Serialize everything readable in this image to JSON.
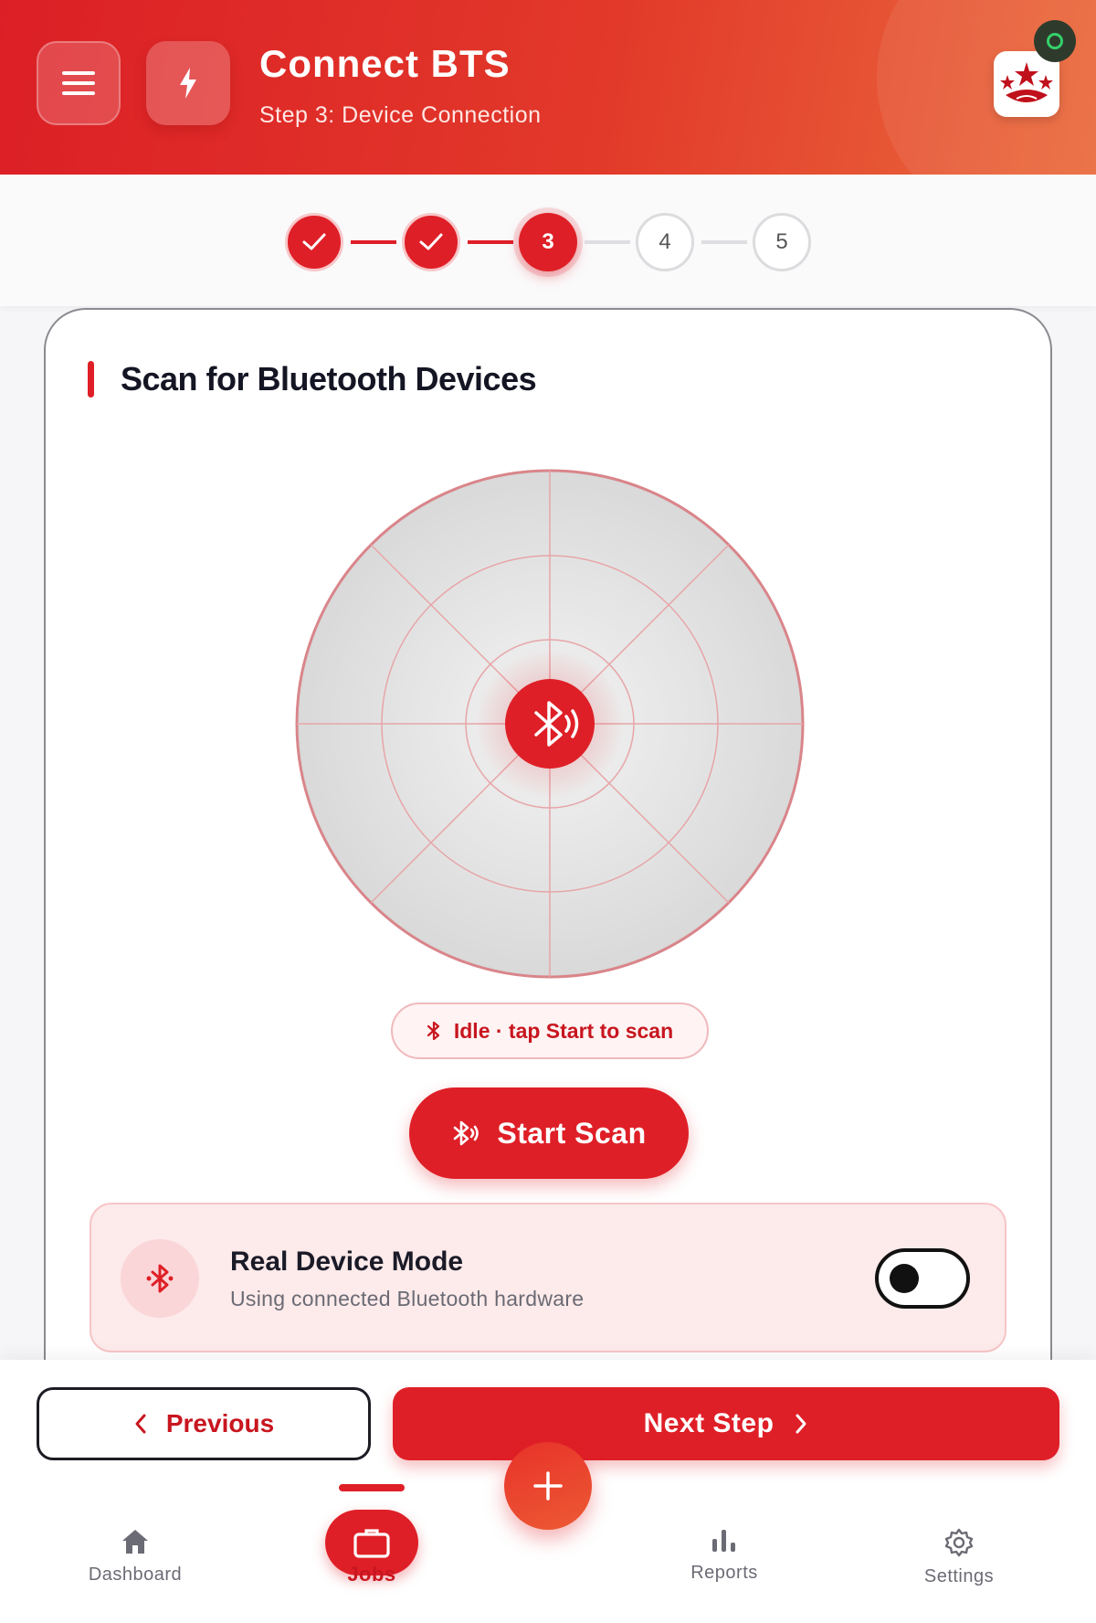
{
  "header": {
    "title": "Connect BTS",
    "subtitle": "Step 3: Device Connection",
    "menu_icon": "menu-icon",
    "bolt_icon": "bolt-icon",
    "brand_icon": "brand-logo",
    "status": "online"
  },
  "stepper": {
    "steps": [
      {
        "label": "",
        "state": "done"
      },
      {
        "label": "",
        "state": "done"
      },
      {
        "label": "3",
        "state": "active"
      },
      {
        "label": "4",
        "state": "todo"
      },
      {
        "label": "5",
        "state": "todo"
      }
    ]
  },
  "card": {
    "title": "Scan for Bluetooth Devices",
    "status_text": "Idle · tap Start to scan",
    "scan_button": "Start Scan",
    "mode": {
      "title": "Real Device Mode",
      "subtitle": "Using connected Bluetooth hardware",
      "toggle_on": false
    }
  },
  "actions": {
    "previous": "Previous",
    "next": "Next Step"
  },
  "nav": {
    "items": [
      {
        "label": "Dashboard",
        "icon": "home-icon"
      },
      {
        "label": "Jobs",
        "icon": "briefcase-icon",
        "active": true
      },
      {
        "label": "Reports",
        "icon": "bar-chart-icon"
      },
      {
        "label": "Settings",
        "icon": "gear-icon"
      }
    ]
  },
  "colors": {
    "primary": "#df1f27",
    "accent": "#ea6a3c",
    "online": "#35d06a"
  }
}
